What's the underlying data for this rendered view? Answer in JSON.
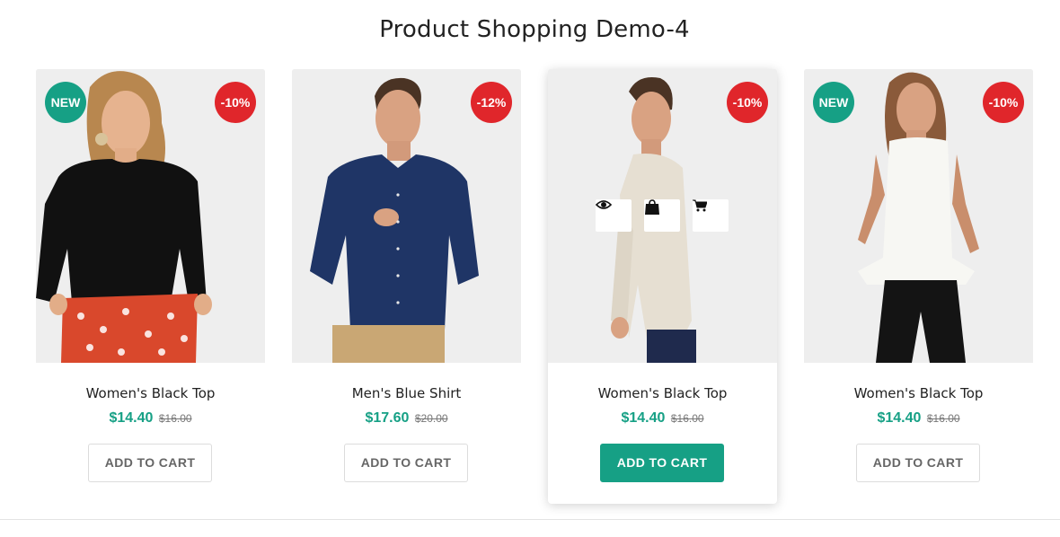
{
  "page": {
    "title": "Product Shopping Demo-4"
  },
  "products": [
    {
      "name": "Women's Black Top",
      "price": "$14.40",
      "old_price": "$16.00",
      "badge_new": "NEW",
      "badge_discount": "-10%",
      "cart_label": "ADD TO CART"
    },
    {
      "name": "Men's Blue Shirt",
      "price": "$17.60",
      "old_price": "$20.00",
      "badge_discount": "-12%",
      "cart_label": "ADD TO CART"
    },
    {
      "name": "Women's Black Top",
      "price": "$14.40",
      "old_price": "$16.00",
      "badge_discount": "-10%",
      "cart_label": "ADD TO CART",
      "actions": [
        "eye-icon",
        "shopping-bag-icon",
        "cart-icon"
      ]
    },
    {
      "name": "Women's Black Top",
      "price": "$14.40",
      "old_price": "$16.00",
      "badge_new": "NEW",
      "badge_discount": "-10%",
      "cart_label": "ADD TO CART"
    }
  ],
  "colors": {
    "accent": "#16a085",
    "sale": "#e0262b",
    "text": "#222222",
    "muted": "#777777"
  }
}
